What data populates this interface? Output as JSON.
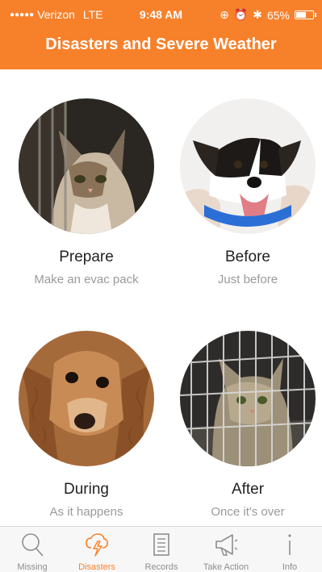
{
  "status_bar": {
    "carrier": "Verizon",
    "network": "LTE",
    "time": "9:48 AM",
    "battery": "65%",
    "battery_level": 0.65
  },
  "header": {
    "title": "Disasters and Severe Weather"
  },
  "tiles": [
    {
      "label": "Prepare",
      "subtitle": "Make an evac pack",
      "photo": "kitten behind cage bars"
    },
    {
      "label": "Before",
      "subtitle": "Just before",
      "photo": "dog in blue collar"
    },
    {
      "label": "During",
      "subtitle": "As it happens",
      "photo": "wet spaniel"
    },
    {
      "label": "After",
      "subtitle": "Once it's over",
      "photo": "cat in wire crate"
    }
  ],
  "tabbar": {
    "active": "Disasters",
    "items": [
      {
        "label": "Missing",
        "icon": "search-icon"
      },
      {
        "label": "Disasters",
        "icon": "storm-icon"
      },
      {
        "label": "Records",
        "icon": "records-icon"
      },
      {
        "label": "Take Action",
        "icon": "megaphone-icon"
      },
      {
        "label": "Info",
        "icon": "info-icon"
      }
    ]
  },
  "colors": {
    "accent": "#f7812b",
    "tab_inactive": "#8e8e8e",
    "subtitle": "#9a9a9a"
  }
}
